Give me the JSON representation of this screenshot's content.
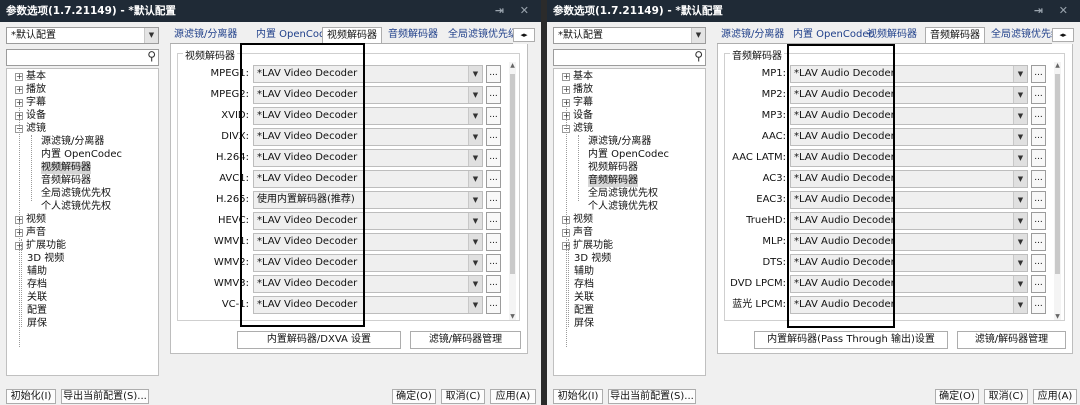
{
  "windows": [
    {
      "title": "参数选项(1.7.21149) - *默认配置",
      "title_buttons": "⇥ ✕",
      "profile": "*默认配置",
      "tabs": [
        {
          "label": "源滤镜/分离器",
          "active": false
        },
        {
          "label": "内置 OpenCodec",
          "active": false
        },
        {
          "label": "视频解码器",
          "active": true
        },
        {
          "label": "音频解码器",
          "active": false
        },
        {
          "label": "全局滤镜优先级",
          "active": false
        }
      ],
      "tree": [
        {
          "label": "基本",
          "expander": "+"
        },
        {
          "label": "播放",
          "expander": "+"
        },
        {
          "label": "字幕",
          "expander": "+"
        },
        {
          "label": "设备",
          "expander": "+"
        },
        {
          "label": "滤镜",
          "expander": "−"
        },
        {
          "label": "源滤镜/分离器",
          "expander": ""
        },
        {
          "label": "内置 OpenCodec",
          "expander": ""
        },
        {
          "label": "视频解码器",
          "expander": ""
        },
        {
          "label": "音频解码器",
          "expander": ""
        },
        {
          "label": "全局滤镜优先权",
          "expander": ""
        },
        {
          "label": "个人滤镜优先权",
          "expander": ""
        },
        {
          "label": "视频",
          "expander": "+"
        },
        {
          "label": "声音",
          "expander": "+"
        },
        {
          "label": "扩展功能",
          "expander": "+"
        },
        {
          "label": "3D 视频",
          "expander": ""
        },
        {
          "label": "辅助",
          "expander": ""
        },
        {
          "label": "存档",
          "expander": ""
        },
        {
          "label": "关联",
          "expander": ""
        },
        {
          "label": "配置",
          "expander": ""
        },
        {
          "label": "屏保",
          "expander": ""
        }
      ],
      "group_title": "视频解码器",
      "rows": [
        {
          "label": "MPEG1:",
          "value": "*LAV Video Decoder"
        },
        {
          "label": "MPEG2:",
          "value": "*LAV Video Decoder"
        },
        {
          "label": "XVID:",
          "value": "*LAV Video Decoder"
        },
        {
          "label": "DIVX:",
          "value": "*LAV Video Decoder"
        },
        {
          "label": "H.264:",
          "value": "*LAV Video Decoder"
        },
        {
          "label": "AVC1:",
          "value": "*LAV Video Decoder"
        },
        {
          "label": "H.265:",
          "value": "使用内置解码器(推荐)"
        },
        {
          "label": "HEVC:",
          "value": "*LAV Video Decoder"
        },
        {
          "label": "WMV1:",
          "value": "*LAV Video Decoder"
        },
        {
          "label": "WMV2:",
          "value": "*LAV Video Decoder"
        },
        {
          "label": "WMV3:",
          "value": "*LAV Video Decoder"
        },
        {
          "label": "VC-1:",
          "value": "*LAV Video Decoder"
        }
      ],
      "more_label": "...",
      "panel_buttons": [
        "内置解码器/DXVA 设置",
        "滤镜/解码器管理"
      ],
      "bottom_left": [
        "初始化(I)",
        "导出当前配置(S)..."
      ],
      "bottom_right": [
        "确定(O)",
        "取消(C)",
        "应用(A)"
      ]
    },
    {
      "title": "参数选项(1.7.21149) - *默认配置",
      "title_buttons": "⇥ ✕",
      "profile": "*默认配置",
      "tabs": [
        {
          "label": "源滤镜/分离器",
          "active": false
        },
        {
          "label": "内置 OpenCodec",
          "active": false
        },
        {
          "label": "视频解码器",
          "active": false
        },
        {
          "label": "音频解码器",
          "active": true
        },
        {
          "label": "全局滤镜优先级",
          "active": false
        }
      ],
      "tree": [
        {
          "label": "基本",
          "expander": "+"
        },
        {
          "label": "播放",
          "expander": "+"
        },
        {
          "label": "字幕",
          "expander": "+"
        },
        {
          "label": "设备",
          "expander": "+"
        },
        {
          "label": "滤镜",
          "expander": "−"
        },
        {
          "label": "源滤镜/分离器",
          "expander": ""
        },
        {
          "label": "内置 OpenCodec",
          "expander": ""
        },
        {
          "label": "视频解码器",
          "expander": ""
        },
        {
          "label": "音频解码器",
          "expander": ""
        },
        {
          "label": "全局滤镜优先权",
          "expander": ""
        },
        {
          "label": "个人滤镜优先权",
          "expander": ""
        },
        {
          "label": "视频",
          "expander": "+"
        },
        {
          "label": "声音",
          "expander": "+"
        },
        {
          "label": "扩展功能",
          "expander": "+"
        },
        {
          "label": "3D 视频",
          "expander": ""
        },
        {
          "label": "辅助",
          "expander": ""
        },
        {
          "label": "存档",
          "expander": ""
        },
        {
          "label": "关联",
          "expander": ""
        },
        {
          "label": "配置",
          "expander": ""
        },
        {
          "label": "屏保",
          "expander": ""
        }
      ],
      "group_title": "音频解码器",
      "rows": [
        {
          "label": "MP1:",
          "value": "*LAV Audio Decoder"
        },
        {
          "label": "MP2:",
          "value": "*LAV Audio Decoder"
        },
        {
          "label": "MP3:",
          "value": "*LAV Audio Decoder"
        },
        {
          "label": "AAC:",
          "value": "*LAV Audio Decoder"
        },
        {
          "label": "AAC LATM:",
          "value": "*LAV Audio Decoder"
        },
        {
          "label": "AC3:",
          "value": "*LAV Audio Decoder"
        },
        {
          "label": "EAC3:",
          "value": "*LAV Audio Decoder"
        },
        {
          "label": "TrueHD:",
          "value": "*LAV Audio Decoder"
        },
        {
          "label": "MLP:",
          "value": "*LAV Audio Decoder"
        },
        {
          "label": "DTS:",
          "value": "*LAV Audio Decoder"
        },
        {
          "label": "DVD LPCM:",
          "value": "*LAV Audio Decoder"
        },
        {
          "label": "蓝光 LPCM:",
          "value": "*LAV Audio Decoder"
        }
      ],
      "more_label": "...",
      "panel_buttons": [
        "内置解码器(Pass Through 输出)设置",
        "滤镜/解码器管理"
      ],
      "bottom_left": [
        "初始化(I)",
        "导出当前配置(S)..."
      ],
      "bottom_right": [
        "确定(O)",
        "取消(C)",
        "应用(A)"
      ]
    }
  ]
}
